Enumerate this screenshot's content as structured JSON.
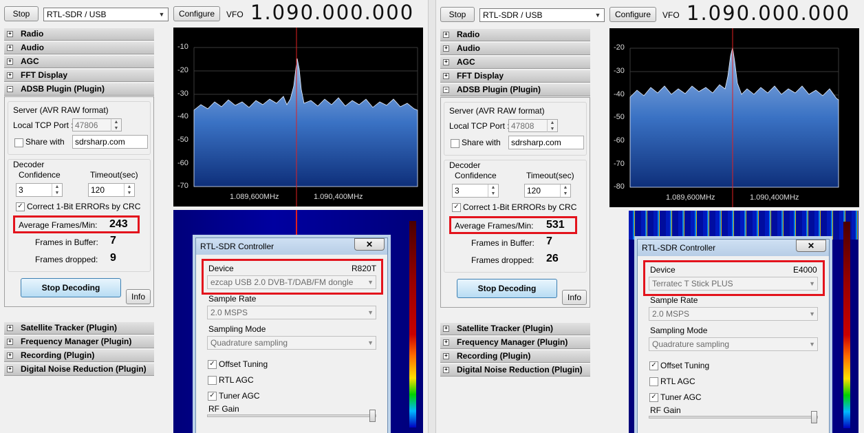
{
  "left": {
    "toolbar": {
      "stop_label": "Stop",
      "source_value": "RTL-SDR / USB",
      "configure_label": "Configure",
      "vfo_label": "VFO",
      "vfo_value": "1.090.000.000"
    },
    "sections_top": [
      {
        "label": "Radio"
      },
      {
        "label": "Audio"
      },
      {
        "label": "AGC"
      },
      {
        "label": "FFT Display"
      },
      {
        "label": "ADSB Plugin (Plugin)"
      }
    ],
    "adsb": {
      "server_title": "Server (AVR RAW format)",
      "local_tcp_port_label": "Local TCP Port :",
      "local_tcp_port_value": "47806",
      "share_with_label": "Share with",
      "share_host": "sdrsharp.com",
      "decoder_title": "Decoder",
      "confidence_label": "Confidence",
      "timeout_label": "Timeout(sec)",
      "confidence_value": "3",
      "timeout_value": "120",
      "crc_label": "Correct 1-Bit ERRORs by CRC",
      "avg_frames_label": "Average Frames/Min:",
      "avg_frames_value": "243",
      "frames_buffer_label": "Frames in Buffer:",
      "frames_buffer_value": "7",
      "frames_dropped_label": "Frames dropped:",
      "frames_dropped_value": "9",
      "stop_decoding_label": "Stop Decoding",
      "info_label": "Info"
    },
    "sections_bottom": [
      {
        "label": "Satellite Tracker (Plugin)"
      },
      {
        "label": "Frequency Manager (Plugin)"
      },
      {
        "label": "Recording (Plugin)"
      },
      {
        "label": "Digital Noise Reduction (Plugin)"
      }
    ],
    "spectrum": {
      "db_labels": [
        "-10",
        "-20",
        "-30",
        "-40",
        "-50",
        "-60",
        "-70"
      ],
      "freq_labels": [
        "1.089,600MHz",
        "1.090,400MHz"
      ]
    },
    "controller": {
      "title": "RTL-SDR Controller",
      "close_label": "✕",
      "device_label": "Device",
      "tuner": "R820T",
      "device_value": "ezcap USB 2.0 DVB-T/DAB/FM dongle",
      "sample_rate_label": "Sample Rate",
      "sample_rate_value": "2.0 MSPS",
      "sampling_mode_label": "Sampling Mode",
      "sampling_mode_value": "Quadrature sampling",
      "offset_tuning_label": "Offset Tuning",
      "rtl_agc_label": "RTL AGC",
      "tuner_agc_label": "Tuner AGC",
      "rf_gain_label": "RF Gain"
    }
  },
  "right": {
    "toolbar": {
      "stop_label": "Stop",
      "source_value": "RTL-SDR / USB",
      "configure_label": "Configure",
      "vfo_label": "VFO",
      "vfo_value": "1.090.000.000"
    },
    "sections_top": [
      {
        "label": "Radio"
      },
      {
        "label": "Audio"
      },
      {
        "label": "AGC"
      },
      {
        "label": "FFT Display"
      },
      {
        "label": "ADSB Plugin (Plugin)"
      }
    ],
    "adsb": {
      "server_title": "Server (AVR RAW format)",
      "local_tcp_port_label": "Local TCP Port :",
      "local_tcp_port_value": "47808",
      "share_with_label": "Share with",
      "share_host": "sdrsharp.com",
      "decoder_title": "Decoder",
      "confidence_label": "Confidence",
      "timeout_label": "Timeout(sec)",
      "confidence_value": "3",
      "timeout_value": "120",
      "crc_label": "Correct 1-Bit ERRORs by CRC",
      "avg_frames_label": "Average Frames/Min:",
      "avg_frames_value": "531",
      "frames_buffer_label": "Frames in Buffer:",
      "frames_buffer_value": "7",
      "frames_dropped_label": "Frames dropped:",
      "frames_dropped_value": "26",
      "stop_decoding_label": "Stop Decoding",
      "info_label": "Info"
    },
    "sections_bottom": [
      {
        "label": "Satellite Tracker (Plugin)"
      },
      {
        "label": "Frequency Manager (Plugin)"
      },
      {
        "label": "Recording (Plugin)"
      },
      {
        "label": "Digital Noise Reduction (Plugin)"
      }
    ],
    "spectrum": {
      "db_labels": [
        "-20",
        "-30",
        "-40",
        "-50",
        "-60",
        "-70",
        "-80"
      ],
      "freq_labels": [
        "1.089,600MHz",
        "1.090,400MHz"
      ]
    },
    "controller": {
      "title": "RTL-SDR Controller",
      "close_label": "✕",
      "device_label": "Device",
      "tuner": "E4000",
      "device_value": "Terratec T Stick PLUS",
      "sample_rate_label": "Sample Rate",
      "sample_rate_value": "2.0 MSPS",
      "sampling_mode_label": "Sampling Mode",
      "sampling_mode_value": "Quadrature sampling",
      "offset_tuning_label": "Offset Tuning",
      "rtl_agc_label": "RTL AGC",
      "tuner_agc_label": "Tuner AGC",
      "rf_gain_label": "RF Gain"
    }
  },
  "colors": {
    "highlight": "#e3131c",
    "spectrum_fill_top": "#8fb3e0",
    "spectrum_fill_bottom": "#123a8a",
    "waterfall_bg": "#00008a"
  },
  "icons": {
    "combo_arrow": "chevron-down-icon",
    "section_toggle": "plus-box-icon",
    "check": "checkmark-icon",
    "close": "close-icon"
  }
}
